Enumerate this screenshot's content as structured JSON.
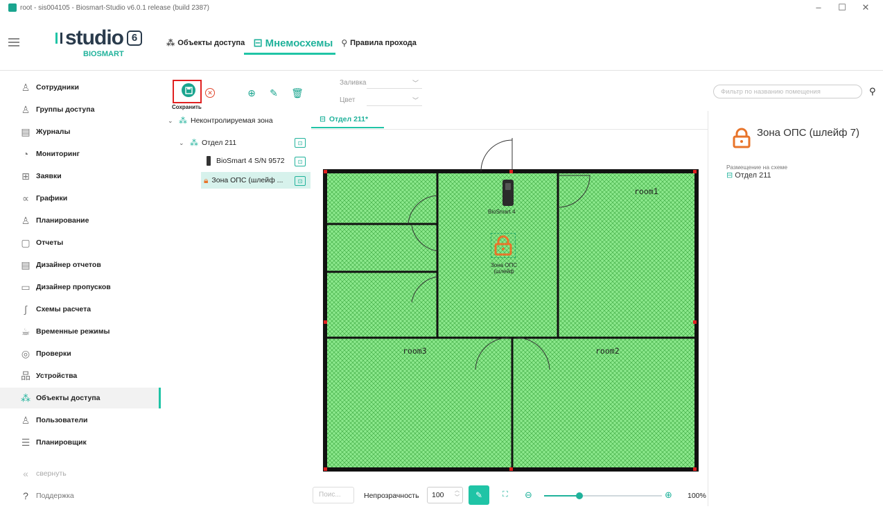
{
  "window": {
    "title": "root - sis004105 - Biosmart-Studio v6.0.1 release (build 2387)",
    "controls": [
      "–",
      "☐",
      "✕"
    ]
  },
  "logo": {
    "main": "studio",
    "version": "6",
    "sub": "BIOSMART"
  },
  "tabs": [
    {
      "label": "Объекты доступа",
      "icon": "network-icon"
    },
    {
      "label": "Мнемосхемы",
      "icon": "plan-icon",
      "active": true
    },
    {
      "label": "Правила прохода",
      "icon": "rules-icon"
    }
  ],
  "sidebar": {
    "items": [
      {
        "label": "Сотрудники",
        "icon": "person-icon"
      },
      {
        "label": "Группы доступа",
        "icon": "group-icon"
      },
      {
        "label": "Журналы",
        "icon": "journal-icon"
      },
      {
        "label": "Мониторинг",
        "icon": "monitor-icon"
      },
      {
        "label": "Заявки",
        "icon": "request-icon"
      },
      {
        "label": "Графики",
        "icon": "graph-icon"
      },
      {
        "label": "Планирование",
        "icon": "planning-icon"
      },
      {
        "label": "Отчеты",
        "icon": "report-icon"
      },
      {
        "label": "Дизайнер отчетов",
        "icon": "report-designer-icon"
      },
      {
        "label": "Дизайнер пропусков",
        "icon": "pass-designer-icon"
      },
      {
        "label": "Схемы расчета",
        "icon": "calc-scheme-icon"
      },
      {
        "label": "Временные режимы",
        "icon": "time-mode-icon"
      },
      {
        "label": "Проверки",
        "icon": "check-icon"
      },
      {
        "label": "Устройства",
        "icon": "device-icon"
      },
      {
        "label": "Объекты доступа",
        "icon": "network-icon",
        "active": true
      },
      {
        "label": "Пользователи",
        "icon": "user-icon"
      },
      {
        "label": "Планировщик",
        "icon": "scheduler-icon"
      }
    ],
    "collapse_label": "свернуть",
    "support_label": "Поддержка"
  },
  "toolbar": {
    "save_label": "Сохранить",
    "fill_label": "Заливка",
    "color_label": "Цвет"
  },
  "filter": {
    "placeholder": "Фильтр по названию помещения"
  },
  "tree": {
    "root": "Неконтролируемая зона",
    "child": "Отдел 211",
    "device": "BioSmart 4 S/N 9572",
    "zone": "Зона ОПС (шлейф ..."
  },
  "plan": {
    "tab_label": "Отдел 211*",
    "rooms": [
      "room1",
      "room2",
      "room3"
    ],
    "device_label": "BioSmart 4",
    "zone_label_line1": "Зона ОПС",
    "zone_label_line2": "(шлейф"
  },
  "bottom": {
    "search_placeholder": "Поис...",
    "opacity_label": "Непрозрачность",
    "opacity_value": "100",
    "zoom_value": "100%",
    "zoom_level": 0.3
  },
  "right_panel": {
    "title": "Зона ОПС (шлейф 7)",
    "placement_label": "Размещение на схеме",
    "placement_value": "Отдел 211"
  },
  "colors": {
    "accent": "#20c4a6",
    "room_fill": "#7ee787",
    "wall": "#111111",
    "alarm": "#e8742a"
  }
}
